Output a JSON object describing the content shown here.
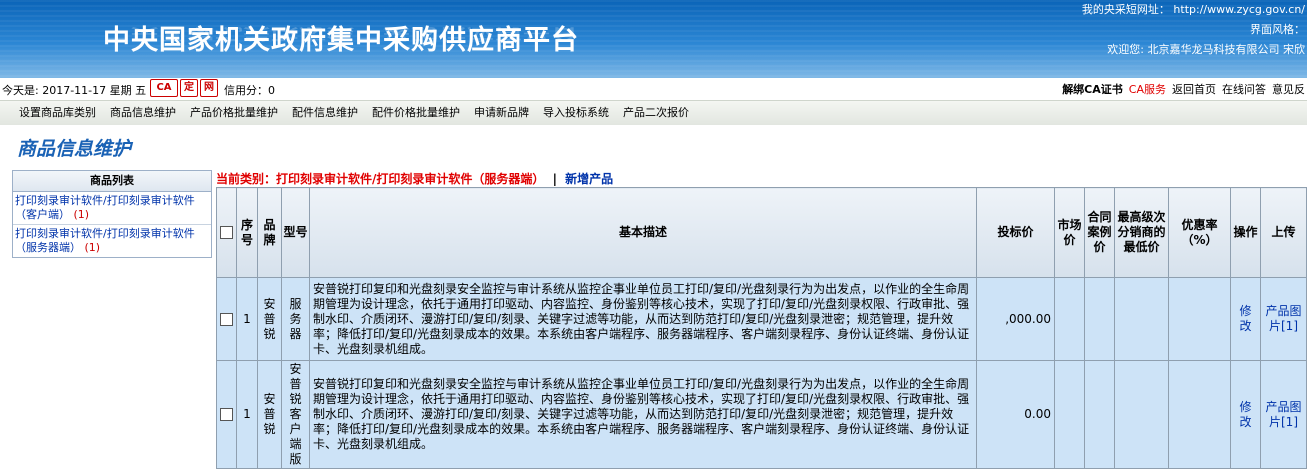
{
  "header": {
    "title": "中央国家机关政府集中采购供应商平台",
    "short_url_label": "我的央采短网址：",
    "short_url": "http://www.zycg.gov.cn/",
    "style_label": "界面风格：",
    "welcome": "欢迎您: 北京嘉华龙马科技有限公司 宋欣"
  },
  "infobar": {
    "date": "今天是: 2017-11-17 星期 五",
    "icons": [
      "ca-icon",
      "ding-icon",
      "wang-icon"
    ],
    "icon_labels": [
      "CA",
      "定",
      "网"
    ],
    "credit": "信用分：0",
    "links": [
      "解绑CA证书",
      "CA服务",
      "返回首页",
      "在线问答",
      "意见反"
    ]
  },
  "nav": {
    "items": [
      "设置商品库类别",
      "商品信息维护",
      "产品价格批量维护",
      "配件信息维护",
      "配件价格批量维护",
      "申请新品牌",
      "导入投标系统",
      "产品二次报价"
    ]
  },
  "page_heading": "商品信息维护",
  "product_list": {
    "title": "商品列表",
    "items": [
      {
        "text": "打印刻录审计软件/打印刻录审计软件（客户端）",
        "count": "(1)"
      },
      {
        "text": "打印刻录审计软件/打印刻录审计软件（服务器端）",
        "count": "(1)"
      }
    ]
  },
  "category": {
    "label": "当前类别：打印刻录审计软件/打印刻录审计软件（服务器端）",
    "separator": "|",
    "add_link": "新增产品"
  },
  "table": {
    "headers": {
      "seq": "序号",
      "brand": "品牌",
      "model": "型号",
      "desc": "基本描述",
      "bid_price": "投标价",
      "market_price": "市场价",
      "contract_price": "合同案例价",
      "lowest_price": "最高级次分销商的最低价",
      "discount": "优惠率（%）",
      "action": "操作",
      "upload": "上传"
    },
    "rows": [
      {
        "seq": "1",
        "brand": "安普锐",
        "model": "服务器",
        "desc": "安普锐打印复印和光盘刻录安全监控与审计系统从监控企事业单位员工打印/复印/光盘刻录行为为出发点，以作业的全生命周期管理为设计理念，依托于通用打印驱动、内容监控、身份鉴别等核心技术，实现了打印/复印/光盘刻录权限、行政审批、强制水印、介质闭环、漫游打印/复印/刻录、关键字过滤等功能，从而达到防范打印/复印/光盘刻录泄密；规范管理，提升效率；降低打印/复印/光盘刻录成本的效果。本系统由客户端程序、服务器端程序、客户端刻录程序、身份认证终端、身份认证卡、光盘刻录机组成。",
        "bid_price": ",000.00",
        "market_price": "",
        "contract_price": "",
        "lowest_price": "",
        "discount": "",
        "action": "修改",
        "upload": "产品图片[1]"
      },
      {
        "seq": "1",
        "brand": "安普锐",
        "model": "安普锐客户端版",
        "desc": "安普锐打印复印和光盘刻录安全监控与审计系统从监控企事业单位员工打印/复印/光盘刻录行为为出发点，以作业的全生命周期管理为设计理念，依托于通用打印驱动、内容监控、身份鉴别等核心技术，实现了打印/复印/光盘刻录权限、行政审批、强制水印、介质闭环、漫游打印/复印/刻录、关键字过滤等功能，从而达到防范打印/复印/光盘刻录泄密；规范管理，提升效率；降低打印/复印/光盘刻录成本的效果。本系统由客户端程序、服务器端程序、客户端刻录程序、身份认证终端、身份认证卡、光盘刻录机组成。",
        "bid_price": "0.00",
        "market_price": "",
        "contract_price": "",
        "lowest_price": "",
        "discount": "",
        "action": "修改",
        "upload": "产品图片[1]"
      }
    ]
  }
}
